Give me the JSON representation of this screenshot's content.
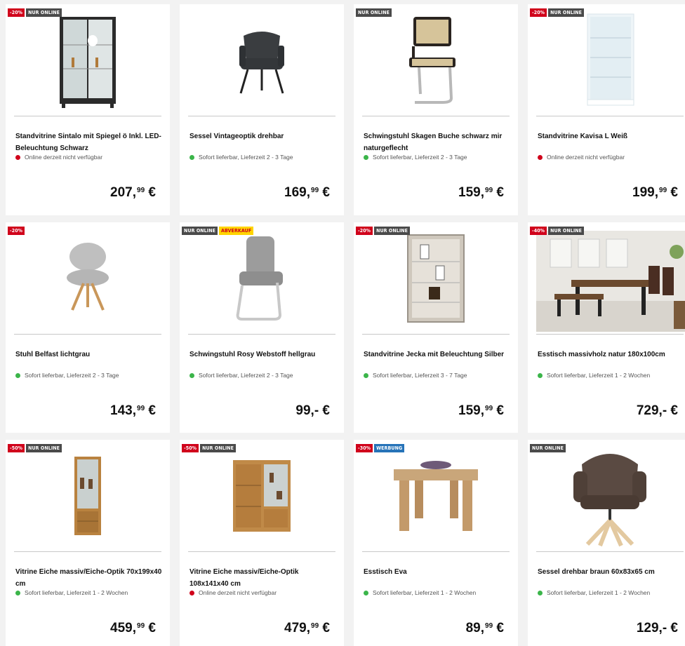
{
  "products": [
    {
      "badges": [
        {
          "text": "-20%",
          "kind": "red"
        },
        {
          "text": "NUR ONLINE",
          "kind": "dark"
        }
      ],
      "title": "Standvitrine Sintalo mit Spiegel ö Inkl. LED-Beleuchtung Schwarz",
      "availability": "Online derzeit nicht verfügbar",
      "status": "red",
      "price_main": "207,",
      "price_sup": "99",
      "currency": "€",
      "image": "glass-cabinet-black"
    },
    {
      "badges": [],
      "title": "Sessel Vintageoptik drehbar",
      "availability": "Sofort lieferbar, Lieferzeit 2 - 3 Tage",
      "status": "green",
      "price_main": "169,",
      "price_sup": "99",
      "currency": "€",
      "image": "armchair-gray"
    },
    {
      "badges": [
        {
          "text": "NUR ONLINE",
          "kind": "dark"
        }
      ],
      "title": "Schwingstuhl Skagen Buche schwarz mir naturgeflecht",
      "availability": "Sofort lieferbar, Lieferzeit 2 - 3 Tage",
      "status": "green",
      "price_main": "159,",
      "price_sup": "99",
      "currency": "€",
      "image": "cantilever-chair-cane"
    },
    {
      "badges": [
        {
          "text": "-20%",
          "kind": "red"
        },
        {
          "text": "NUR ONLINE",
          "kind": "dark"
        }
      ],
      "title": "Standvitrine Kavisa L Weiß",
      "availability": "Online derzeit nicht verfügbar",
      "status": "red",
      "price_main": "199,",
      "price_sup": "99",
      "currency": "€",
      "image": "glass-cabinet-white"
    },
    {
      "badges": [
        {
          "text": "-20%",
          "kind": "red"
        }
      ],
      "title": "Stuhl Belfast lichtgrau",
      "availability": "Sofort lieferbar, Lieferzeit 2 - 3 Tage",
      "status": "green",
      "price_main": "143,",
      "price_sup": "99",
      "currency": "€",
      "image": "chair-light-gray"
    },
    {
      "badges": [
        {
          "text": "NUR ONLINE",
          "kind": "dark"
        },
        {
          "text": "ABVERKAUF",
          "kind": "yellow"
        }
      ],
      "title": "Schwingstuhl Rosy Webstoff hellgrau",
      "availability": "Sofort lieferbar, Lieferzeit 2 - 3 Tage",
      "status": "green",
      "price_main": "99,- €",
      "price_sup": "",
      "currency": "",
      "image": "cantilever-chair-gray"
    },
    {
      "badges": [
        {
          "text": "-20%",
          "kind": "red"
        },
        {
          "text": "NUR ONLINE",
          "kind": "dark"
        }
      ],
      "title": "Standvitrine Jecka mit Beleuchtung Silber",
      "availability": "Sofort lieferbar, Lieferzeit 3 - 7 Tage",
      "status": "green",
      "price_main": "159,",
      "price_sup": "99",
      "currency": "€",
      "image": "corner-cabinet-silver"
    },
    {
      "badges": [
        {
          "text": "-40%",
          "kind": "red"
        },
        {
          "text": "NUR ONLINE",
          "kind": "dark"
        }
      ],
      "title": "Esstisch massivholz natur 180x100cm",
      "availability": "Sofort lieferbar, Lieferzeit 1 - 2 Wochen",
      "status": "green",
      "price_main": "729,- €",
      "price_sup": "",
      "currency": "",
      "image": "dining-room-photo"
    },
    {
      "badges": [
        {
          "text": "-50%",
          "kind": "red"
        },
        {
          "text": "NUR ONLINE",
          "kind": "dark"
        }
      ],
      "title": "Vitrine Eiche massiv/Eiche-Optik 70x199x40 cm",
      "availability": "Sofort lieferbar, Lieferzeit 1 - 2 Wochen",
      "status": "green",
      "price_main": "459,",
      "price_sup": "99",
      "currency": "€",
      "image": "oak-vitrine-tall"
    },
    {
      "badges": [
        {
          "text": "-50%",
          "kind": "red"
        },
        {
          "text": "NUR ONLINE",
          "kind": "dark"
        }
      ],
      "title": "Vitrine Eiche massiv/Eiche-Optik 108x141x40 cm",
      "availability": "Online derzeit nicht verfügbar",
      "status": "red",
      "price_main": "479,",
      "price_sup": "99",
      "currency": "€",
      "image": "oak-vitrine-wide"
    },
    {
      "badges": [
        {
          "text": "-30%",
          "kind": "red"
        },
        {
          "text": "WERBUNG",
          "kind": "blue"
        }
      ],
      "title": "Esstisch Eva",
      "availability": "Sofort lieferbar, Lieferzeit 1 - 2 Wochen",
      "status": "green",
      "price_main": "89,",
      "price_sup": "99",
      "currency": "€",
      "image": "small-table-oak"
    },
    {
      "badges": [
        {
          "text": "NUR ONLINE",
          "kind": "dark"
        }
      ],
      "title": "Sessel drehbar braun 60x83x65 cm",
      "availability": "Sofort lieferbar, Lieferzeit 1 - 2 Wochen",
      "status": "green",
      "price_main": "129,- €",
      "price_sup": "",
      "currency": "",
      "image": "swivel-armchair-brown"
    }
  ],
  "colors": {
    "sale_red": "#d0021b",
    "online_dark": "#4a4a4a",
    "clearance_yellow": "#ffd400",
    "ad_blue": "#2673b8",
    "available_green": "#3bb54a"
  }
}
